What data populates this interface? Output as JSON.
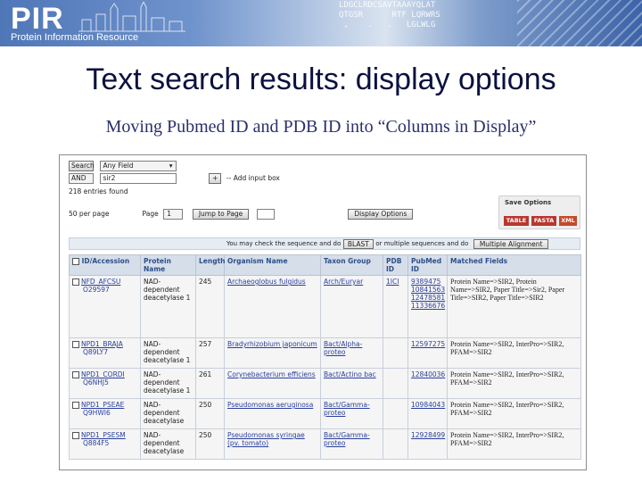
{
  "banner": {
    "logo": "PIR",
    "subtitle": "Protein Information Resource",
    "sequence_text": "LDGCLRDCSAVTAAAYQLAT\nQTGSR      RTF LQRWRS\n ,    .   .   LGLWLG"
  },
  "title": "Text search results: display options",
  "subtitle": "Moving Pubmed ID and PDB ID into “Columns in Display”",
  "screenshot": {
    "search": {
      "button_label": "Search",
      "field_select": "Any Field",
      "bool_select": "AND",
      "query_value": "sir2",
      "add_input_label": "+",
      "add_input_text": "-- Add input box"
    },
    "entries_found": "218 entries found",
    "per_page": "50 per page",
    "page_label": "Page",
    "page_select": "1",
    "jump_button": "Jump to Page",
    "display_options_button": "Display Options",
    "save_options": {
      "title": "Save Options",
      "formats": [
        "TABLE",
        "FASTA",
        "XML"
      ],
      "format_colors": [
        "#c0302a",
        "#c0302a",
        "#c0302a"
      ]
    },
    "action_text_1": "You may check the sequence and do",
    "blast_button": "BLAST",
    "action_text_2": "or multiple sequences and do",
    "msa_button": "Multiple Alignment",
    "table": {
      "headers": [
        "ID/Accession",
        "Protein Name",
        "Length",
        "Organism Name",
        "Taxon Group",
        "PDB ID",
        "PubMed ID",
        "Matched Fields"
      ],
      "rows": [
        {
          "id": "NFD_AFCSU",
          "acc": "O29597",
          "protein": "NAD-dependent deacetylase 1",
          "length": "245",
          "organism": "Archaeoglobus fulgidus",
          "taxon": "Arch/Euryar",
          "pdb": "1ICI",
          "pubmed": "9389475\n10841563\n12478581\n11336676",
          "fields": "Protein Name=>SIR2, Protein Name=>SIR2, Paper Title=>Sir2, Paper Title=>SIR2, Paper Title=>SIR2"
        },
        {
          "id": "NPD1_BRAJA",
          "acc": "Q89LY7",
          "protein": "NAD-dependent deacetylase 1",
          "length": "257",
          "organism": "Bradyrhizobium japonicum",
          "taxon": "Bact/Alpha-proteo",
          "pdb": "",
          "pubmed": "12597275",
          "fields": "Protein Name=>SIR2, InterPro=>SIR2, PFAM=>SIR2"
        },
        {
          "id": "NPD1_CORDI",
          "acc": "Q6NHJ5",
          "protein": "NAD-dependent deacetylase 1",
          "length": "261",
          "organism": "Corynebacterium efficiens",
          "taxon": "Bact/Actino bac",
          "pdb": "",
          "pubmed": "12840036",
          "fields": "Protein Name=>SIR2, InterPro=>SIR2, PFAM=>SIR2"
        },
        {
          "id": "NPD1_PSEAE",
          "acc": "Q9HWI6",
          "protein": "NAD-dependent deacetylase",
          "length": "250",
          "organism": "Pseudomonas aeruginosa",
          "taxon": "Bact/Gamma-proteo",
          "pdb": "",
          "pubmed": "10984043",
          "fields": "Protein Name=>SIR2, InterPro=>SIR2, PFAM=>SIR2"
        },
        {
          "id": "NPD1_PSESM",
          "acc": "Q884F5",
          "protein": "NAD-dependent deacetylase",
          "length": "250",
          "organism": "Pseudomonas syringae (pv. tomato)",
          "taxon": "Bact/Gamma-proteo",
          "pdb": "",
          "pubmed": "12928499",
          "fields": "Protein Name=>SIR2, InterPro=>SIR2, PFAM=>SIR2"
        }
      ]
    }
  }
}
